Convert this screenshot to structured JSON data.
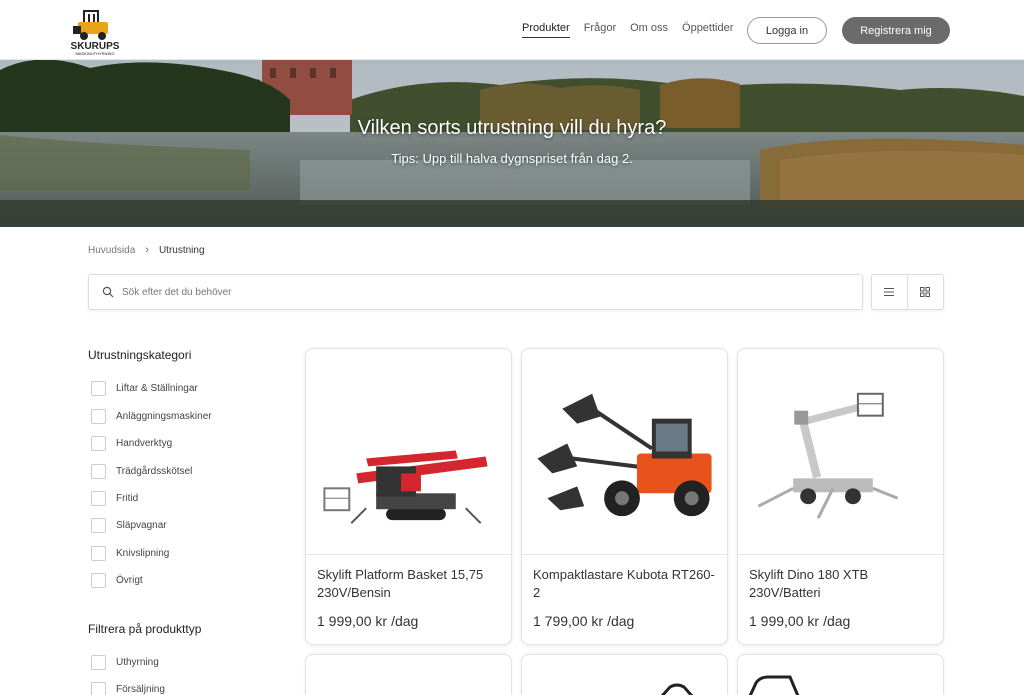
{
  "brand": {
    "name": "SKURUPS",
    "tagline": "MASKINUTHYRNING"
  },
  "nav": {
    "items": [
      {
        "label": "Produkter",
        "active": true
      },
      {
        "label": "Frågor",
        "active": false
      },
      {
        "label": "Om oss",
        "active": false
      },
      {
        "label": "Öppettider",
        "active": false
      }
    ],
    "login_label": "Logga in",
    "register_label": "Registrera mig"
  },
  "hero": {
    "title": "Vilken sorts utrustning vill du hyra?",
    "subtitle": "Tips: Upp till halva dygnspriset från dag 2."
  },
  "breadcrumb": {
    "home": "Huvudsida",
    "current": "Utrustning"
  },
  "search": {
    "placeholder": "Sök efter det du behöver"
  },
  "filters": {
    "category_heading": "Utrustningskategori",
    "categories": [
      "Liftar & Ställningar",
      "Anläggningsmaskiner",
      "Handverktyg",
      "Trädgårdsskötsel",
      "Fritid",
      "Släpvagnar",
      "Knivslipning",
      "Övrigt"
    ],
    "type_heading": "Filtrera på produkttyp",
    "types": [
      "Uthyrning",
      "Försäljning"
    ]
  },
  "products": [
    {
      "title": "Skylift Platform Basket 15,75 230V/Bensin",
      "price": "1 999,00 kr",
      "unit": "/dag"
    },
    {
      "title": "Kompaktlastare Kubota RT260-2",
      "price": "1 799,00 kr",
      "unit": "/dag"
    },
    {
      "title": "Skylift Dino 180 XTB 230V/Batteri",
      "price": "1 999,00 kr",
      "unit": "/dag"
    }
  ],
  "colors": {
    "register_bg": "#6b6b6b",
    "accent_red": "#d4262e",
    "kubota_orange": "#e8531c"
  }
}
